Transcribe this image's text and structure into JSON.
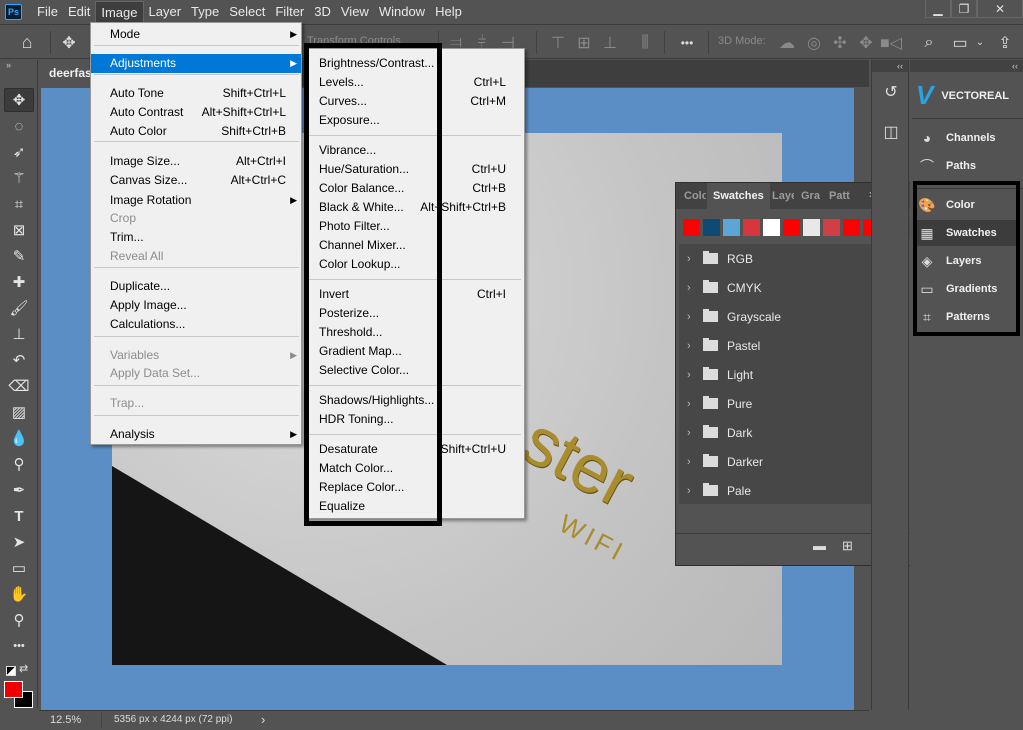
{
  "app": {
    "logo": "Ps"
  },
  "menubar": {
    "items": [
      "File",
      "Edit",
      "Image",
      "Layer",
      "Type",
      "Select",
      "Filter",
      "3D",
      "View",
      "Window",
      "Help"
    ],
    "active": "Image"
  },
  "window_controls": {
    "minimize": "▁",
    "restore": "❐",
    "close": "✕"
  },
  "optionsbar": {
    "transform_controls": "Transform Controls",
    "mode_3d": "3D Mode:",
    "more": "•••"
  },
  "document": {
    "tab_title": "deerfast",
    "image_text": "ster",
    "image_subtext": "WIFI"
  },
  "statusbar": {
    "zoom": "12.5%",
    "info": "5356 px x 4244 px (72 ppi)",
    "arrow": "›"
  },
  "image_menu": {
    "items": [
      {
        "label": "Mode",
        "shortcut": "",
        "submenu": true,
        "disabled": false
      },
      {
        "label": "Adjustments",
        "shortcut": "",
        "submenu": true,
        "disabled": false,
        "highlighted": true
      },
      {
        "label": "Auto Tone",
        "shortcut": "Shift+Ctrl+L",
        "disabled": false
      },
      {
        "label": "Auto Contrast",
        "shortcut": "Alt+Shift+Ctrl+L",
        "disabled": false
      },
      {
        "label": "Auto Color",
        "shortcut": "Shift+Ctrl+B",
        "disabled": false
      },
      {
        "label": "Image Size...",
        "shortcut": "Alt+Ctrl+I",
        "disabled": false
      },
      {
        "label": "Canvas Size...",
        "shortcut": "Alt+Ctrl+C",
        "disabled": false
      },
      {
        "label": "Image Rotation",
        "shortcut": "",
        "submenu": true,
        "disabled": false
      },
      {
        "label": "Crop",
        "shortcut": "",
        "disabled": true
      },
      {
        "label": "Trim...",
        "shortcut": "",
        "disabled": false
      },
      {
        "label": "Reveal All",
        "shortcut": "",
        "disabled": true
      },
      {
        "label": "Duplicate...",
        "shortcut": "",
        "disabled": false
      },
      {
        "label": "Apply Image...",
        "shortcut": "",
        "disabled": false
      },
      {
        "label": "Calculations...",
        "shortcut": "",
        "disabled": false
      },
      {
        "label": "Variables",
        "shortcut": "",
        "submenu": true,
        "disabled": true
      },
      {
        "label": "Apply Data Set...",
        "shortcut": "",
        "disabled": true
      },
      {
        "label": "Trap...",
        "shortcut": "",
        "disabled": true
      },
      {
        "label": "Analysis",
        "shortcut": "",
        "submenu": true,
        "disabled": false
      }
    ]
  },
  "adjustments_menu": {
    "items": [
      {
        "label": "Brightness/Contrast...",
        "shortcut": ""
      },
      {
        "label": "Levels...",
        "shortcut": "Ctrl+L"
      },
      {
        "label": "Curves...",
        "shortcut": "Ctrl+M"
      },
      {
        "label": "Exposure...",
        "shortcut": ""
      },
      {
        "label": "Vibrance...",
        "shortcut": ""
      },
      {
        "label": "Hue/Saturation...",
        "shortcut": "Ctrl+U"
      },
      {
        "label": "Color Balance...",
        "shortcut": "Ctrl+B"
      },
      {
        "label": "Black & White...",
        "shortcut": "Alt+Shift+Ctrl+B"
      },
      {
        "label": "Photo Filter...",
        "shortcut": ""
      },
      {
        "label": "Channel Mixer...",
        "shortcut": ""
      },
      {
        "label": "Color Lookup...",
        "shortcut": ""
      },
      {
        "label": "Invert",
        "shortcut": "Ctrl+I"
      },
      {
        "label": "Posterize...",
        "shortcut": ""
      },
      {
        "label": "Threshold...",
        "shortcut": ""
      },
      {
        "label": "Gradient Map...",
        "shortcut": ""
      },
      {
        "label": "Selective Color...",
        "shortcut": ""
      },
      {
        "label": "Shadows/Highlights...",
        "shortcut": ""
      },
      {
        "label": "HDR Toning...",
        "shortcut": ""
      },
      {
        "label": "Desaturate",
        "shortcut": "Shift+Ctrl+U"
      },
      {
        "label": "Match Color...",
        "shortcut": ""
      },
      {
        "label": "Replace Color...",
        "shortcut": ""
      },
      {
        "label": "Equalize",
        "shortcut": ""
      }
    ]
  },
  "swatches_panel": {
    "tabs": [
      "Colo",
      "Swatches",
      "Laye",
      "Gra",
      "Patt"
    ],
    "active_tab": "Swatches",
    "more": "»",
    "menu": "≡",
    "recent_swatches": [
      "#ff0000",
      "#0e4a73",
      "#5ba6d4",
      "#d6373f",
      "#ffffff",
      "#ff0000",
      "#e8e8e8",
      "#d13f45",
      "#ff0000",
      "#ff0000",
      "#fa0000",
      "#ff0000"
    ],
    "folders": [
      "RGB",
      "CMYK",
      "Grayscale",
      "Pastel",
      "Light",
      "Pure",
      "Dark",
      "Darker",
      "Pale"
    ]
  },
  "dock": {
    "collapse": "‹‹",
    "brand": "VECTOREAL",
    "group1": [
      {
        "label": "Channels",
        "icon": "◕"
      },
      {
        "label": "Paths",
        "icon": "⌒"
      }
    ],
    "group2": [
      {
        "label": "Color",
        "icon": "🎨"
      },
      {
        "label": "Swatches",
        "icon": "▦",
        "active": true
      },
      {
        "label": "Layers",
        "icon": "◈"
      },
      {
        "label": "Gradients",
        "icon": "▭"
      },
      {
        "label": "Patterns",
        "icon": "⌗"
      }
    ]
  },
  "colors": {
    "foreground": "#ee0000",
    "background": "#000000",
    "canvas_bg": "#5b8ec4",
    "menu_highlight": "#0078d7"
  }
}
